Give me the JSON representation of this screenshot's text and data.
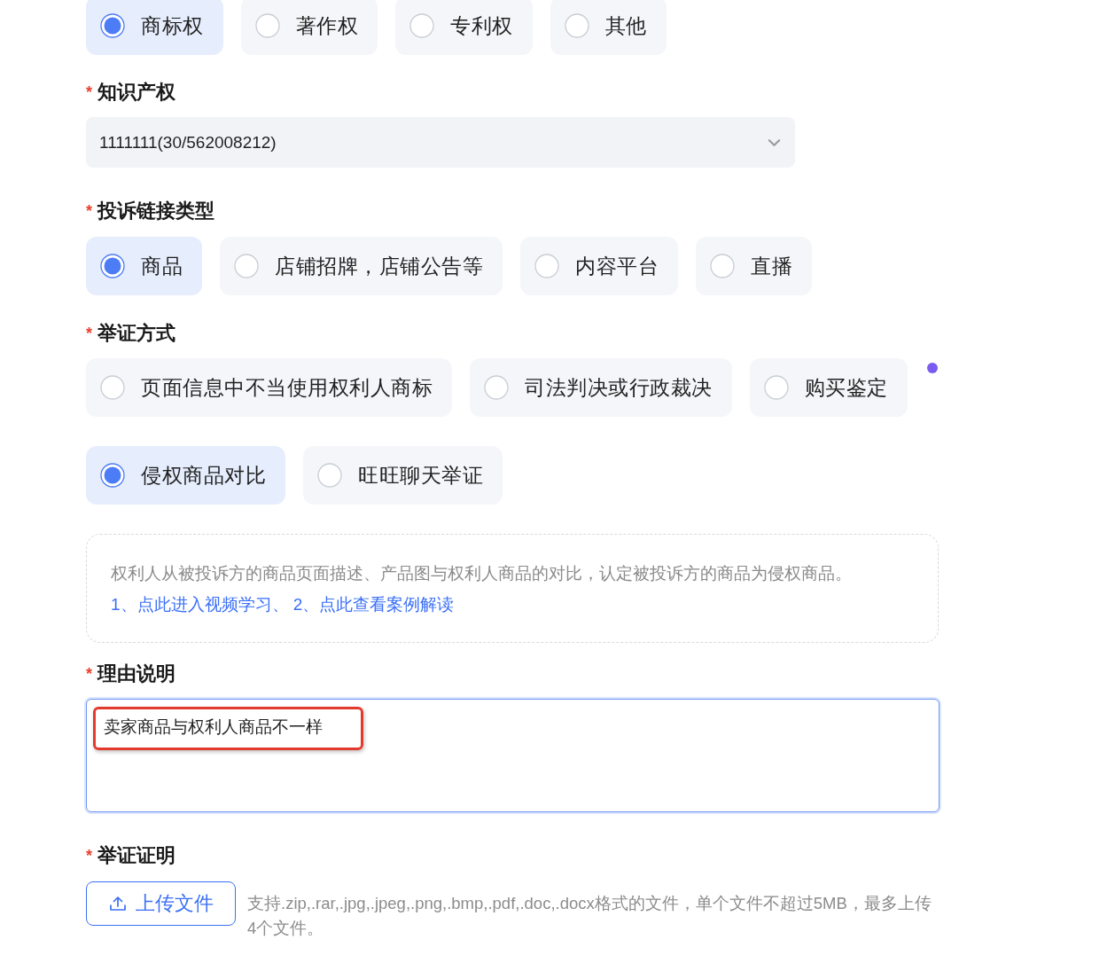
{
  "right_type": {
    "options": [
      {
        "label": "商标权",
        "selected": true
      },
      {
        "label": "著作权",
        "selected": false
      },
      {
        "label": "专利权",
        "selected": false
      },
      {
        "label": "其他",
        "selected": false
      }
    ]
  },
  "intellectual_property": {
    "mark": "*",
    "label": "知识产权",
    "value": "1111111(30/562008212)"
  },
  "link_type": {
    "mark": "*",
    "label": "投诉链接类型",
    "options": [
      {
        "label": "商品",
        "selected": true
      },
      {
        "label": "店铺招牌，店铺公告等",
        "selected": false
      },
      {
        "label": "内容平台",
        "selected": false
      },
      {
        "label": "直播",
        "selected": false
      }
    ]
  },
  "evidence_method": {
    "mark": "*",
    "label": "举证方式",
    "indicator_dot": true,
    "rows": [
      {
        "options": [
          {
            "label": "页面信息中不当使用权利人商标",
            "selected": false
          },
          {
            "label": "司法判决或行政裁决",
            "selected": false
          },
          {
            "label": "购买鉴定",
            "selected": false
          }
        ]
      },
      {
        "options": [
          {
            "label": "侵权商品对比",
            "selected": true
          },
          {
            "label": "旺旺聊天举证",
            "selected": false
          }
        ]
      }
    ]
  },
  "tip": {
    "text": "权利人从被投诉方的商品页面描述、产品图与权利人商品的对比，认定被投诉方的商品为侵权商品。",
    "links": [
      "1、点此进入视频学习、",
      "2、点此查看案例解读"
    ]
  },
  "reason": {
    "mark": "*",
    "label": "理由说明",
    "value": "卖家商品与权利人商品不一样",
    "focused": true,
    "annotated": true
  },
  "evidence_proof": {
    "mark": "*",
    "label": "举证证明",
    "upload_button": "上传文件",
    "hint": "支持.zip,.rar,.jpg,.jpeg,.png,.bmp,.pdf,.doc,.docx格式的文件，单个文件不超过5MB，最多上传4个文件。"
  }
}
